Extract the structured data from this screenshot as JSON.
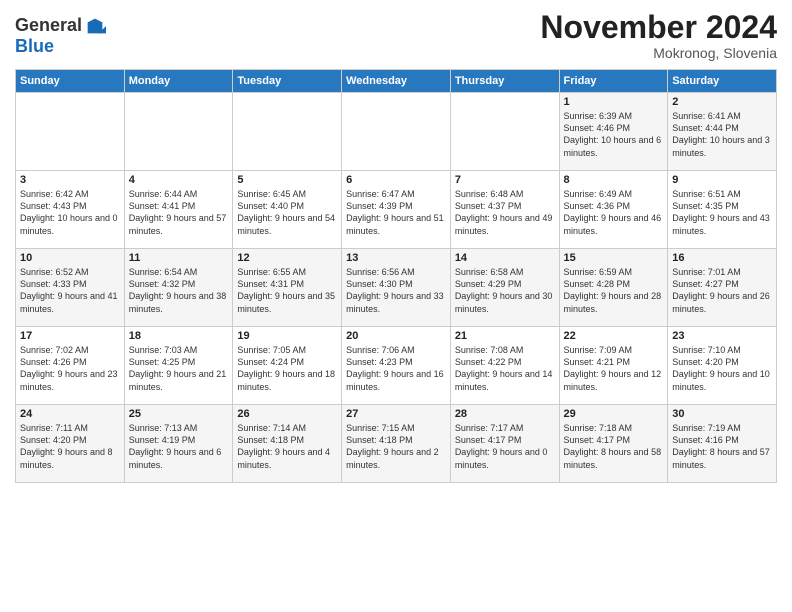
{
  "header": {
    "logo_general": "General",
    "logo_blue": "Blue",
    "month_title": "November 2024",
    "location": "Mokronog, Slovenia"
  },
  "weekdays": [
    "Sunday",
    "Monday",
    "Tuesday",
    "Wednesday",
    "Thursday",
    "Friday",
    "Saturday"
  ],
  "weeks": [
    [
      {
        "day": "",
        "info": ""
      },
      {
        "day": "",
        "info": ""
      },
      {
        "day": "",
        "info": ""
      },
      {
        "day": "",
        "info": ""
      },
      {
        "day": "",
        "info": ""
      },
      {
        "day": "1",
        "info": "Sunrise: 6:39 AM\nSunset: 4:46 PM\nDaylight: 10 hours and 6 minutes."
      },
      {
        "day": "2",
        "info": "Sunrise: 6:41 AM\nSunset: 4:44 PM\nDaylight: 10 hours and 3 minutes."
      }
    ],
    [
      {
        "day": "3",
        "info": "Sunrise: 6:42 AM\nSunset: 4:43 PM\nDaylight: 10 hours and 0 minutes."
      },
      {
        "day": "4",
        "info": "Sunrise: 6:44 AM\nSunset: 4:41 PM\nDaylight: 9 hours and 57 minutes."
      },
      {
        "day": "5",
        "info": "Sunrise: 6:45 AM\nSunset: 4:40 PM\nDaylight: 9 hours and 54 minutes."
      },
      {
        "day": "6",
        "info": "Sunrise: 6:47 AM\nSunset: 4:39 PM\nDaylight: 9 hours and 51 minutes."
      },
      {
        "day": "7",
        "info": "Sunrise: 6:48 AM\nSunset: 4:37 PM\nDaylight: 9 hours and 49 minutes."
      },
      {
        "day": "8",
        "info": "Sunrise: 6:49 AM\nSunset: 4:36 PM\nDaylight: 9 hours and 46 minutes."
      },
      {
        "day": "9",
        "info": "Sunrise: 6:51 AM\nSunset: 4:35 PM\nDaylight: 9 hours and 43 minutes."
      }
    ],
    [
      {
        "day": "10",
        "info": "Sunrise: 6:52 AM\nSunset: 4:33 PM\nDaylight: 9 hours and 41 minutes."
      },
      {
        "day": "11",
        "info": "Sunrise: 6:54 AM\nSunset: 4:32 PM\nDaylight: 9 hours and 38 minutes."
      },
      {
        "day": "12",
        "info": "Sunrise: 6:55 AM\nSunset: 4:31 PM\nDaylight: 9 hours and 35 minutes."
      },
      {
        "day": "13",
        "info": "Sunrise: 6:56 AM\nSunset: 4:30 PM\nDaylight: 9 hours and 33 minutes."
      },
      {
        "day": "14",
        "info": "Sunrise: 6:58 AM\nSunset: 4:29 PM\nDaylight: 9 hours and 30 minutes."
      },
      {
        "day": "15",
        "info": "Sunrise: 6:59 AM\nSunset: 4:28 PM\nDaylight: 9 hours and 28 minutes."
      },
      {
        "day": "16",
        "info": "Sunrise: 7:01 AM\nSunset: 4:27 PM\nDaylight: 9 hours and 26 minutes."
      }
    ],
    [
      {
        "day": "17",
        "info": "Sunrise: 7:02 AM\nSunset: 4:26 PM\nDaylight: 9 hours and 23 minutes."
      },
      {
        "day": "18",
        "info": "Sunrise: 7:03 AM\nSunset: 4:25 PM\nDaylight: 9 hours and 21 minutes."
      },
      {
        "day": "19",
        "info": "Sunrise: 7:05 AM\nSunset: 4:24 PM\nDaylight: 9 hours and 18 minutes."
      },
      {
        "day": "20",
        "info": "Sunrise: 7:06 AM\nSunset: 4:23 PM\nDaylight: 9 hours and 16 minutes."
      },
      {
        "day": "21",
        "info": "Sunrise: 7:08 AM\nSunset: 4:22 PM\nDaylight: 9 hours and 14 minutes."
      },
      {
        "day": "22",
        "info": "Sunrise: 7:09 AM\nSunset: 4:21 PM\nDaylight: 9 hours and 12 minutes."
      },
      {
        "day": "23",
        "info": "Sunrise: 7:10 AM\nSunset: 4:20 PM\nDaylight: 9 hours and 10 minutes."
      }
    ],
    [
      {
        "day": "24",
        "info": "Sunrise: 7:11 AM\nSunset: 4:20 PM\nDaylight: 9 hours and 8 minutes."
      },
      {
        "day": "25",
        "info": "Sunrise: 7:13 AM\nSunset: 4:19 PM\nDaylight: 9 hours and 6 minutes."
      },
      {
        "day": "26",
        "info": "Sunrise: 7:14 AM\nSunset: 4:18 PM\nDaylight: 9 hours and 4 minutes."
      },
      {
        "day": "27",
        "info": "Sunrise: 7:15 AM\nSunset: 4:18 PM\nDaylight: 9 hours and 2 minutes."
      },
      {
        "day": "28",
        "info": "Sunrise: 7:17 AM\nSunset: 4:17 PM\nDaylight: 9 hours and 0 minutes."
      },
      {
        "day": "29",
        "info": "Sunrise: 7:18 AM\nSunset: 4:17 PM\nDaylight: 8 hours and 58 minutes."
      },
      {
        "day": "30",
        "info": "Sunrise: 7:19 AM\nSunset: 4:16 PM\nDaylight: 8 hours and 57 minutes."
      }
    ]
  ]
}
